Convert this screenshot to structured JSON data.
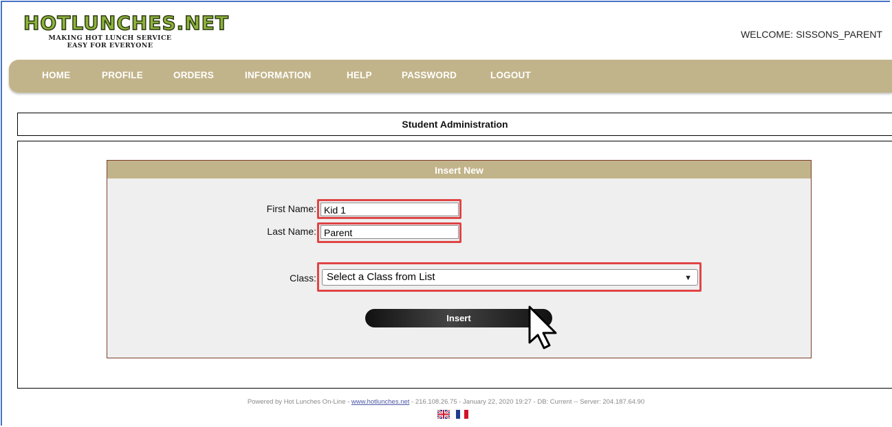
{
  "header": {
    "logo_main": "HOTLUNCHES.NET",
    "logo_tagline_1": "MAKING HOT LUNCH SERVICE",
    "logo_tagline_2": "EASY FOR EVERYONE",
    "welcome": "WELCOME: SISSONS_PARENT"
  },
  "nav": {
    "items": [
      "HOME",
      "PROFILE",
      "ORDERS",
      "INFORMATION",
      "HELP",
      "PASSWORD",
      "LOGOUT"
    ]
  },
  "page": {
    "title": "Student Administration",
    "panel_title": "Insert New"
  },
  "form": {
    "first_name_label": "First Name:",
    "first_name_value": "Kid 1",
    "last_name_label": "Last Name:",
    "last_name_value": "Parent",
    "class_label": "Class:",
    "class_selected": "Select a Class from List",
    "insert_label": "Insert"
  },
  "footer": {
    "prefix": "Powered by Hot Lunches On-Line - ",
    "link": "www.hotlunches.net",
    "suffix": " - 216.108.26.75 - January 22, 2020 19:27 - DB: Current -- Server: 204.187.64.90"
  },
  "colors": {
    "nav_bg": "#c2b48a",
    "highlight": "#e04444",
    "logo_green": "#8db33a"
  },
  "icons": [
    "uk-flag-icon",
    "france-flag-icon",
    "mouse-cursor-icon",
    "dropdown-caret-icon"
  ]
}
